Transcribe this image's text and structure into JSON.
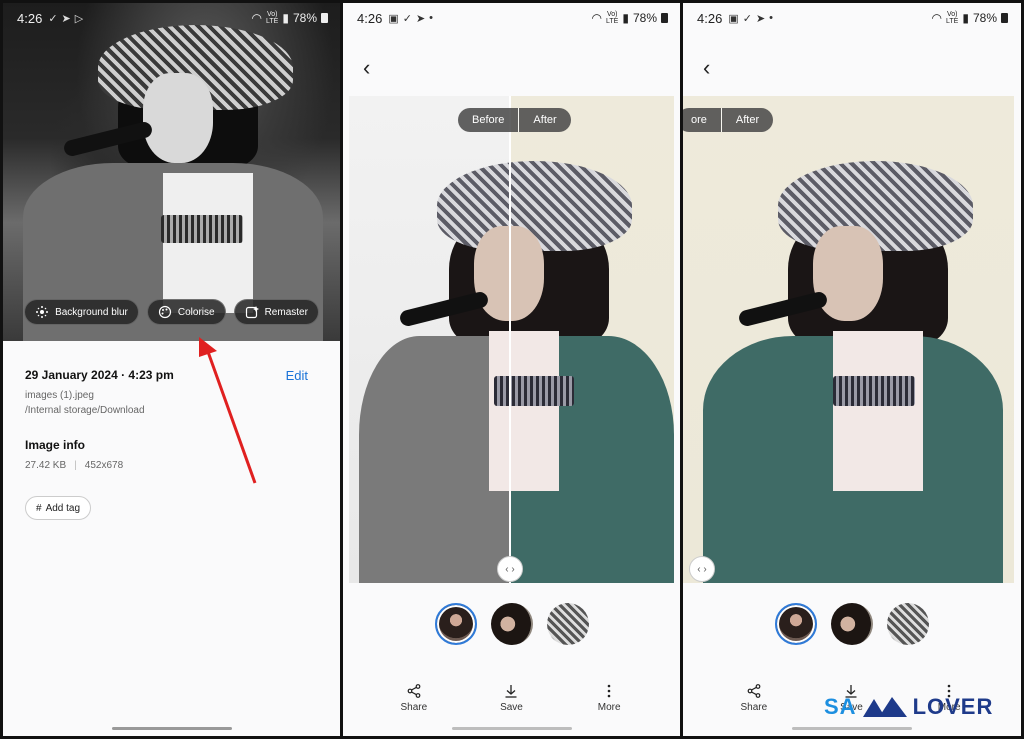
{
  "status": {
    "time": "4:26",
    "battery": "78%",
    "lte": "Vo) LTE"
  },
  "panel1": {
    "chips": [
      "Background blur",
      "Colorise",
      "Remaster"
    ],
    "date": "29 January 2024 · 4:23 pm",
    "edit": "Edit",
    "filename": "images (1).jpeg",
    "path": "/Internal storage/Download",
    "image_info": "Image info",
    "size": "27.42 KB",
    "dimensions": "452x678",
    "add_tag": "Add tag"
  },
  "panel2": {
    "before": "Before",
    "after": "After"
  },
  "panel3": {
    "before": "ore",
    "after": "After"
  },
  "actions": {
    "share": "Share",
    "save": "Save",
    "more": "More"
  },
  "watermark": {
    "left": "SA",
    "right": "LOVER"
  },
  "colors": {
    "accent": "#1a73d8",
    "arrow": "#e02020",
    "selection_ring": "#2f7ad8"
  }
}
